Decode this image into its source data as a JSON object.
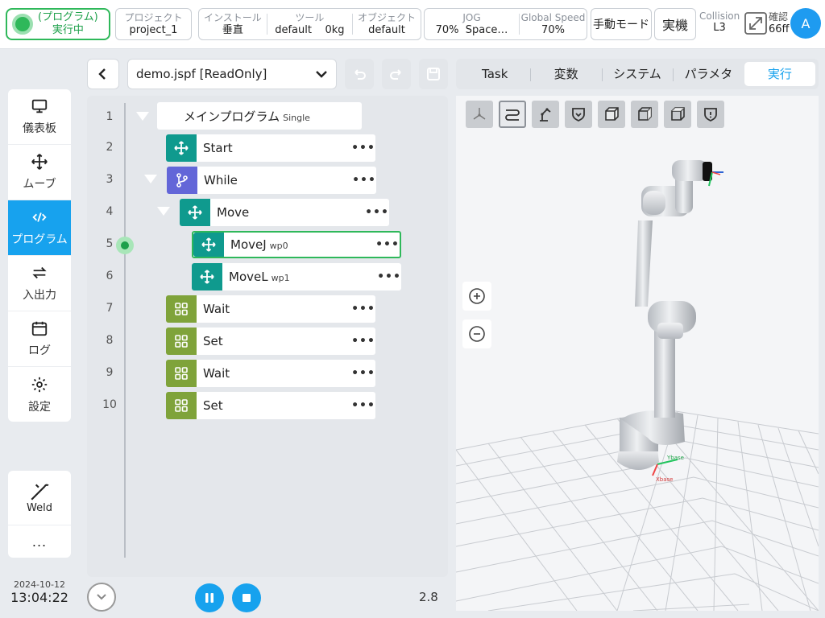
{
  "topbar": {
    "status": {
      "line1": "(プログラム)",
      "line2": "実行中"
    },
    "project": {
      "label": "プロジェクト",
      "value": "project_1"
    },
    "install": {
      "label": "インストール",
      "value": "垂直"
    },
    "tool": {
      "label": "ツール",
      "value": "default",
      "weight": "0kg"
    },
    "object": {
      "label": "オブジェクト",
      "value": "default"
    },
    "jog": {
      "label": "JOG",
      "value": "70%",
      "space": "Space…"
    },
    "global_speed": {
      "label": "Global Speed",
      "value": "70%"
    },
    "manual_mode": "手動モード",
    "real_machine": "実機",
    "collision": {
      "label": "Collision",
      "value": "L3"
    },
    "confirm": {
      "line1": "確認",
      "line2": "66ff"
    },
    "avatar": "A"
  },
  "nav": {
    "items": [
      {
        "label": "儀表板",
        "icon": "monitor-icon"
      },
      {
        "label": "ムーブ",
        "icon": "move-arrows-icon"
      },
      {
        "label": "プログラム",
        "icon": "code-icon"
      },
      {
        "label": "入出力",
        "icon": "io-arrows-icon"
      },
      {
        "label": "ログ",
        "icon": "calendar-icon"
      },
      {
        "label": "設定",
        "icon": "gear-icon"
      }
    ],
    "weld": "Weld",
    "more": "...",
    "date": "2024-10-12",
    "time": "13:04:22"
  },
  "program": {
    "file": "demo.jspf [ReadOnly]",
    "root": {
      "name": "メインプログラム",
      "tag": "Single"
    },
    "lines": [
      {
        "n": "1"
      },
      {
        "n": "2",
        "name": "Start",
        "sub": ""
      },
      {
        "n": "3",
        "name": "While",
        "sub": ""
      },
      {
        "n": "4",
        "name": "Move",
        "sub": ""
      },
      {
        "n": "5",
        "name": "MoveJ",
        "sub": "wp0"
      },
      {
        "n": "6",
        "name": "MoveL",
        "sub": "wp1"
      },
      {
        "n": "7",
        "name": "Wait",
        "sub": ""
      },
      {
        "n": "8",
        "name": "Set",
        "sub": ""
      },
      {
        "n": "9",
        "name": "Wait",
        "sub": ""
      },
      {
        "n": "10",
        "name": "Set",
        "sub": ""
      }
    ],
    "more": "•••",
    "speed": "2.8"
  },
  "tabs": [
    "Task",
    "変数",
    "システム",
    "パラメタ",
    "実行"
  ],
  "axis_labels": {
    "x": "Xbase",
    "y": "Ybase"
  },
  "colors": {
    "accent": "#17a2ee",
    "running": "#2fb85a",
    "teal": "#0f9a8e",
    "purple": "#6366d8",
    "olive": "#7fa33a"
  }
}
